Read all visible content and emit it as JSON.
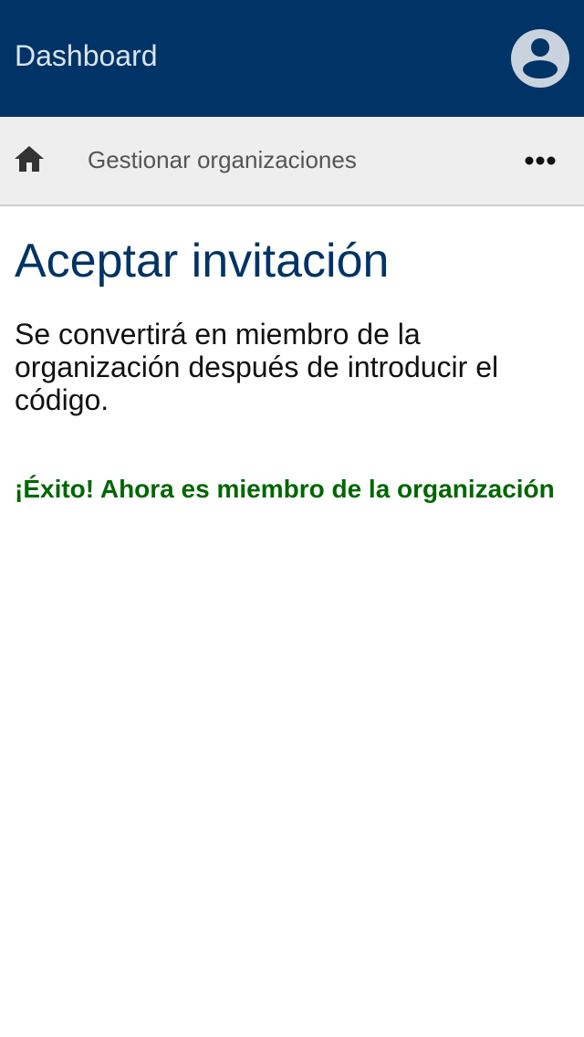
{
  "header": {
    "title": "Dashboard",
    "avatar_icon": "account-circle-icon",
    "background": "#003366"
  },
  "subheader": {
    "home_icon": "home-icon",
    "title": "Gestionar organizaciones",
    "more_icon": "more-horizontal-icon"
  },
  "main": {
    "title": "Aceptar invitación",
    "description": "Se convertirá en miembro de la organización después de introducir el código.",
    "success_message": "¡Éxito! Ahora es miembro de la organización",
    "success_color": "#006600"
  }
}
